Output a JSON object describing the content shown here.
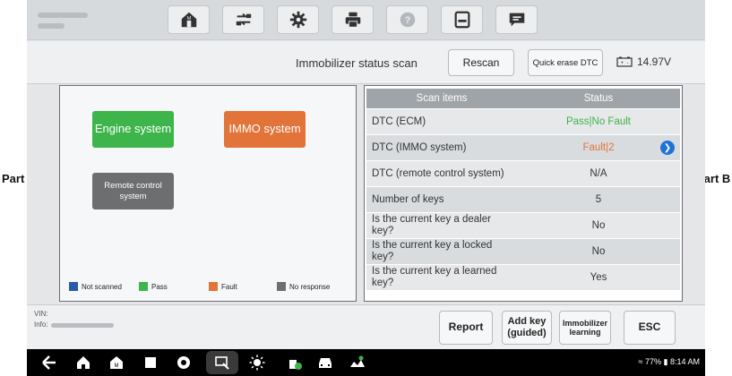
{
  "callouts": {
    "left": "Part A",
    "right": "Part B"
  },
  "toolbar": {
    "icons": [
      "home-icon",
      "vehicle-swap-icon",
      "settings-icon",
      "print-icon",
      "help-icon",
      "save-icon",
      "message-icon"
    ]
  },
  "status_row": {
    "title": "Immobilizer status scan",
    "rescan_label": "Rescan",
    "quick_erase_label": "Quick erase DTC",
    "battery_voltage": "14.97V"
  },
  "part_a": {
    "systems": [
      {
        "label": "Engine system",
        "color": "#3db54a"
      },
      {
        "label": "IMMO system",
        "color": "#e2743a"
      },
      {
        "label": "Remote control system",
        "color": "#6d6e70"
      }
    ],
    "legend": [
      {
        "label": "Not scanned",
        "color": "#2a5ba8"
      },
      {
        "label": "Pass",
        "color": "#3db54a"
      },
      {
        "label": "Fault",
        "color": "#e2743a"
      },
      {
        "label": "No response",
        "color": "#6d6e70"
      }
    ]
  },
  "part_b": {
    "headers": [
      "Scan items",
      "Status"
    ],
    "rows": [
      {
        "item": "DTC (ECM)",
        "status": "Pass|No Fault",
        "status_color": "#3db54a"
      },
      {
        "item": "DTC (IMMO system)",
        "status": "Fault|2",
        "status_color": "#e2743a"
      },
      {
        "item": "DTC (remote control system)",
        "status": "N/A",
        "status_color": "#555555"
      },
      {
        "item": "Number of keys",
        "status": "5",
        "status_color": "#555555"
      },
      {
        "item": "Is the current key a dealer key?",
        "status": "No",
        "status_color": "#555555"
      },
      {
        "item": "Is the current key a locked key?",
        "status": "No",
        "status_color": "#555555"
      },
      {
        "item": "Is the current key a learned key?",
        "status": "Yes",
        "status_color": "#555555"
      }
    ]
  },
  "bottom": {
    "vin_label": "VIN:",
    "info_label": "Info:",
    "report_label": "Report",
    "add_key_label": "Add key (guided)",
    "immo_learning_label": "Immobilizer learning",
    "esc_label": "ESC"
  },
  "system_bar": {
    "battery_percent": "77%",
    "time": "8:14 AM"
  }
}
